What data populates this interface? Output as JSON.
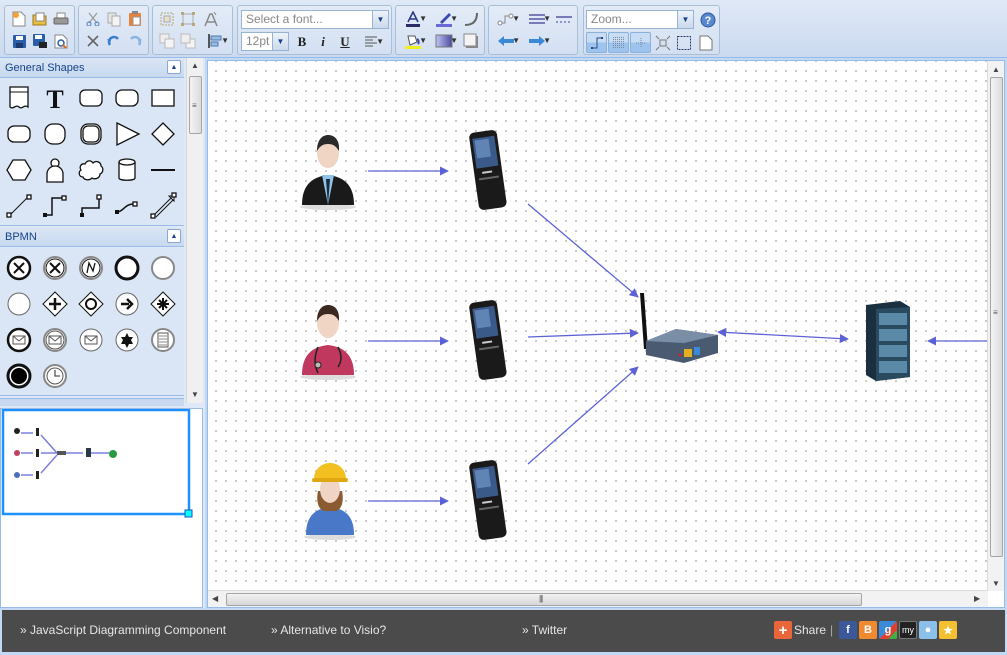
{
  "toolbar": {
    "file": [
      "new-file",
      "open-file",
      "print",
      "save",
      "save-as",
      "print-preview"
    ],
    "edit": [
      "cut",
      "copy",
      "paste",
      "delete",
      "undo",
      "redo"
    ],
    "arrange": [
      "group",
      "ungroup",
      "text-style",
      "bring-forward",
      "send-backward",
      "align"
    ],
    "font_placeholder": "Select a font...",
    "font_size": "12pt",
    "bold_label": "B",
    "italic_label": "i",
    "underline_label": "U",
    "zoom_placeholder": "Zoom...",
    "colors": {
      "font_underline": "#2b2b6a",
      "line_color": "#6a6ad6",
      "fill_color": "#f0f020"
    }
  },
  "sidebar": {
    "panels": [
      {
        "title": "General Shapes",
        "shapes": [
          "document",
          "text",
          "rounded-rect",
          "rounded-rect-2",
          "rectangle",
          "rounded-square",
          "circle-rect",
          "double-rounded",
          "triangle",
          "diamond",
          "hexagon",
          "actor",
          "cloud",
          "cylinder",
          "line",
          "straight-connector",
          "orthogonal-connector",
          "orthogonal-connector-2",
          "curved-connector",
          "double-arrow"
        ]
      },
      {
        "title": "BPMN",
        "shapes": [
          "cancel-end",
          "cancel-intermediate",
          "link-event",
          "end-event",
          "intermediate-event",
          "start-event",
          "parallel-gateway",
          "inclusive-gateway",
          "event-gateway-arrow",
          "complex-gateway",
          "message-end",
          "message-intermediate",
          "message-start",
          "multiple-event",
          "conditional-event",
          "terminate-event",
          "timer-event"
        ]
      }
    ]
  },
  "diagram": {
    "nodes": [
      {
        "id": "businessman",
        "type": "person"
      },
      {
        "id": "doctor",
        "type": "person"
      },
      {
        "id": "worker",
        "type": "person"
      },
      {
        "id": "phone-1",
        "type": "phone"
      },
      {
        "id": "phone-2",
        "type": "phone"
      },
      {
        "id": "phone-3",
        "type": "phone"
      },
      {
        "id": "router",
        "type": "router"
      },
      {
        "id": "server",
        "type": "server"
      },
      {
        "id": "internet",
        "type": "globe"
      }
    ],
    "edge_color": "#5c62d6"
  },
  "footer": {
    "links": [
      "» JavaScript Diagramming Component",
      "» Alternative to Visio?",
      "» Twitter"
    ],
    "share_label": "Share",
    "separator": "|",
    "social": [
      "facebook",
      "blogger",
      "google",
      "myspace",
      "live",
      "favorites"
    ]
  }
}
